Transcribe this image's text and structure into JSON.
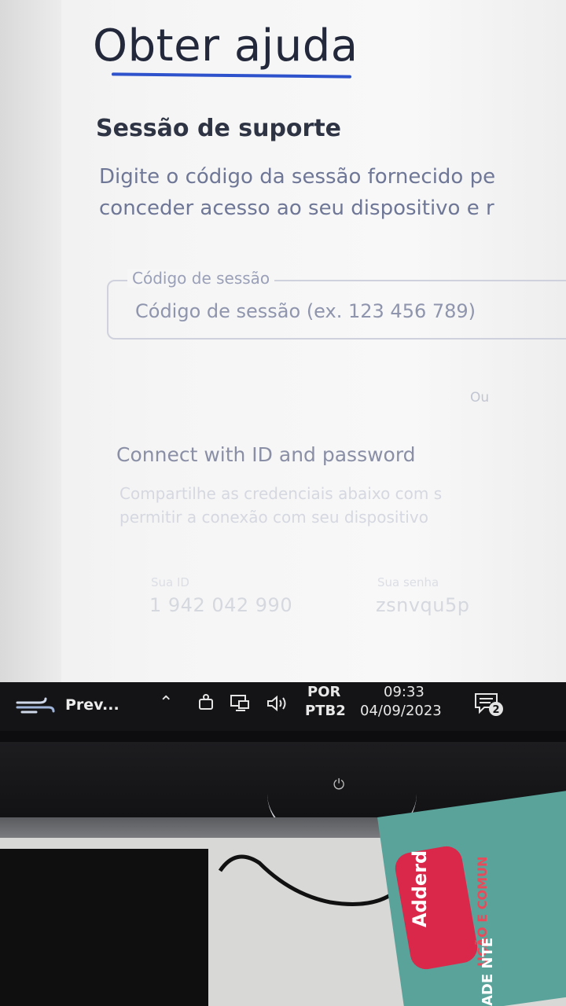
{
  "screen": {
    "title": "Obter ajuda",
    "support_heading": "Sessão de suporte",
    "description_line1": "Digite o código da sessão fornecido pe",
    "description_line2": "conceder acesso ao seu dispositivo e r",
    "session_field": {
      "label": "Código de sessão",
      "placeholder": "Código de sessão (ex. 123 456 789)",
      "value": ""
    },
    "or_text": "Ou",
    "connect_heading": "Connect with ID and password",
    "share_line1": "Compartilhe as credenciais abaixo com s",
    "share_line2": "permitir a conexão com seu dispositivo",
    "credentials": {
      "id_label": "Sua ID",
      "id_value": "1 942 042 990",
      "password_label": "Sua senha",
      "password_value": "zsnvqu5p"
    }
  },
  "taskbar": {
    "app_label": "Prev...",
    "app_icon": "wind-icon",
    "tray_icons": [
      "chevron-up-icon",
      "meet-icon",
      "network-icon",
      "volume-icon"
    ],
    "language_line1": "POR",
    "language_line2": "PTB2",
    "time": "09:33",
    "date": "04/09/2023",
    "notification_count": "2"
  },
  "photo_scene": {
    "book_logo_text": "Adderd",
    "book_side_text": "UÇÃO E COMUN",
    "book_white_text": "ADE NTE"
  },
  "colors": {
    "title_underline": "#2d52cc",
    "title_text": "#23283a",
    "taskbar_bg": "#141416"
  }
}
